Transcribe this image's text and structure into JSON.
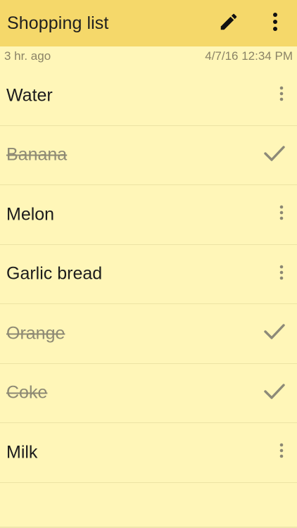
{
  "header": {
    "title": "Shopping list",
    "edit_icon": "pencil-icon",
    "more_icon": "more-vertical-icon",
    "background": "#f5d86a"
  },
  "meta": {
    "relative_time": "3 hr. ago",
    "timestamp": "4/7/16 12:34 PM"
  },
  "items": [
    {
      "label": "Water",
      "done": false
    },
    {
      "label": "Banana",
      "done": true
    },
    {
      "label": "Melon",
      "done": false
    },
    {
      "label": "Garlic bread",
      "done": false
    },
    {
      "label": "Orange",
      "done": true
    },
    {
      "label": "Coke",
      "done": true
    },
    {
      "label": "Milk",
      "done": false
    }
  ],
  "colors": {
    "note_background": "#fff6b8",
    "check_color": "#8d8a78"
  }
}
